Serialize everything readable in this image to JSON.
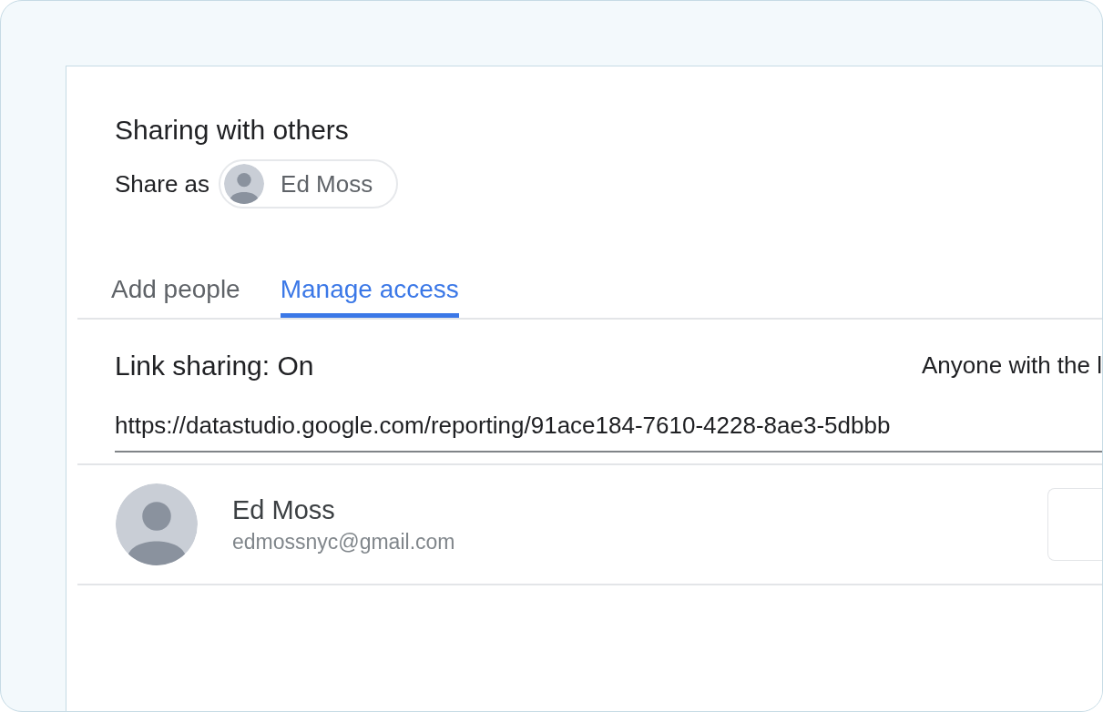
{
  "header": {
    "title": "Sharing with others",
    "share_as_label": "Share as",
    "share_as_name": "Ed Moss"
  },
  "tabs": [
    {
      "label": "Add people",
      "selected": false
    },
    {
      "label": "Manage access",
      "selected": true
    }
  ],
  "link_sharing": {
    "status": "Link sharing: On",
    "access": "Anyone with the l",
    "url": "https://datastudio.google.com/reporting/91ace184-7610-4228-8ae3-5dbbb"
  },
  "people": [
    {
      "name": "Ed Moss",
      "email": "edmossnyc@gmail.com"
    }
  ]
}
